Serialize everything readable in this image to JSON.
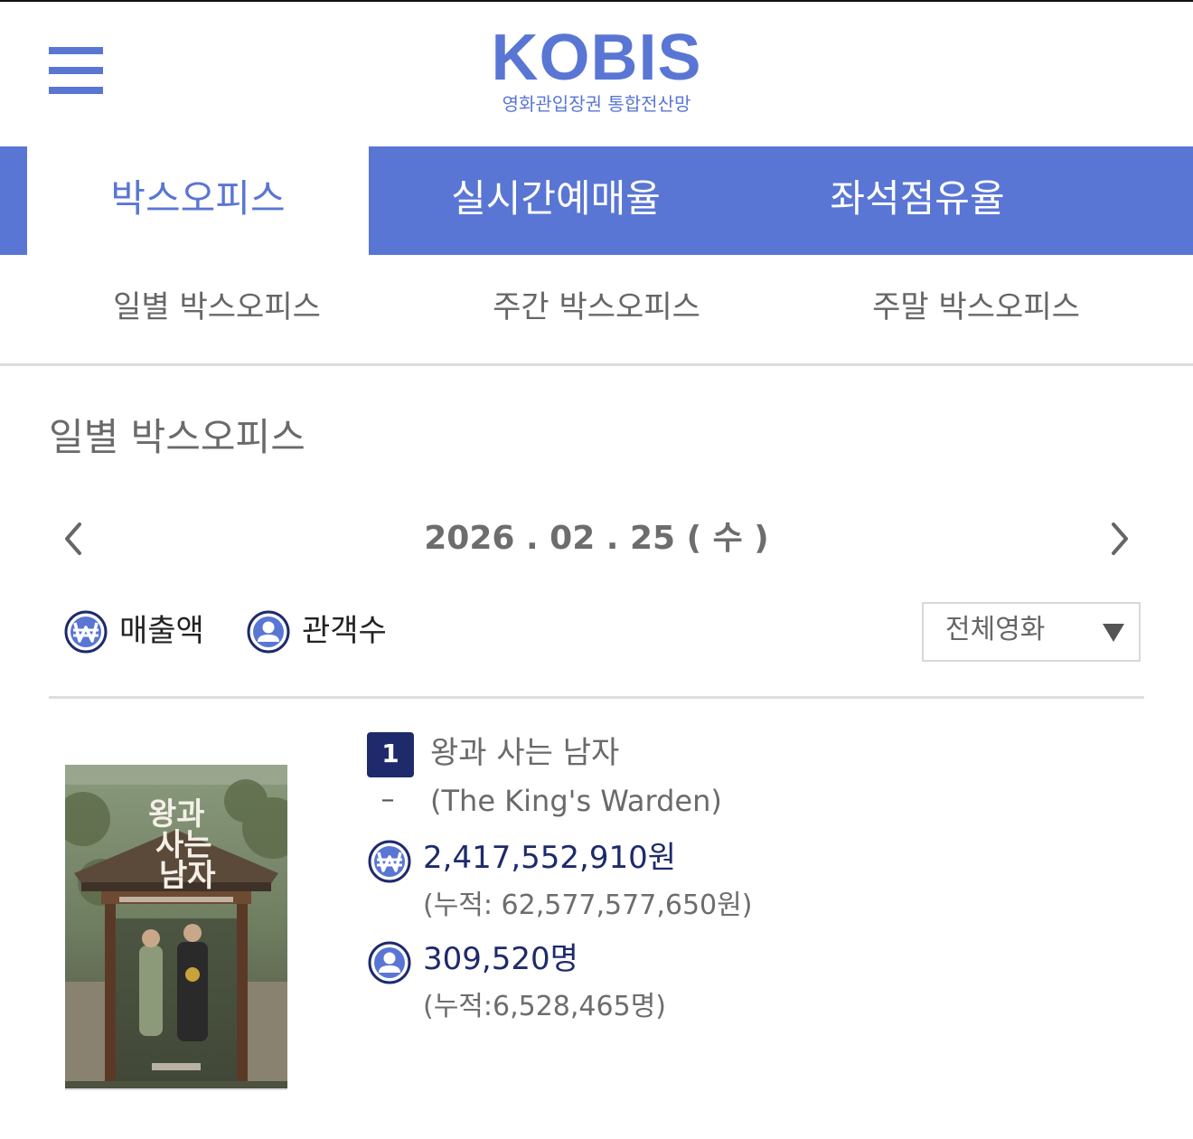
{
  "header": {
    "logo_text": "KOBIS",
    "logo_subtitle": "영화관입장권 통합전산망"
  },
  "tabs": [
    {
      "label": "박스오피스",
      "active": true
    },
    {
      "label": "실시간예매율",
      "active": false
    },
    {
      "label": "좌석점유율",
      "active": false
    }
  ],
  "subtabs": [
    "일별 박스오피스",
    "주간 박스오피스",
    "주말 박스오피스"
  ],
  "section_title": "일별 박스오피스",
  "date_label": "2026 . 02 . 25 ( 수 )",
  "toggles": {
    "sales_label": "매출액",
    "audience_label": "관객수"
  },
  "filter": {
    "selected": "전체영화"
  },
  "movies": [
    {
      "rank": "1",
      "rank_change": "–",
      "title": "왕과 사는 남자",
      "title_en": "(The King's Warden)",
      "sales": "2,417,552,910원",
      "sales_cumulative": "(누적: 62,577,577,650원)",
      "audience": "309,520명",
      "audience_cumulative": "(누적:6,528,465명)"
    }
  ],
  "colors": {
    "brand": "#5a76d4",
    "rank_badge": "#1e2a6b",
    "value_text": "#1e2a6b"
  },
  "icons": [
    "menu-icon",
    "chevron-left-icon",
    "chevron-right-icon",
    "won-icon",
    "person-icon",
    "caret-down-icon"
  ]
}
